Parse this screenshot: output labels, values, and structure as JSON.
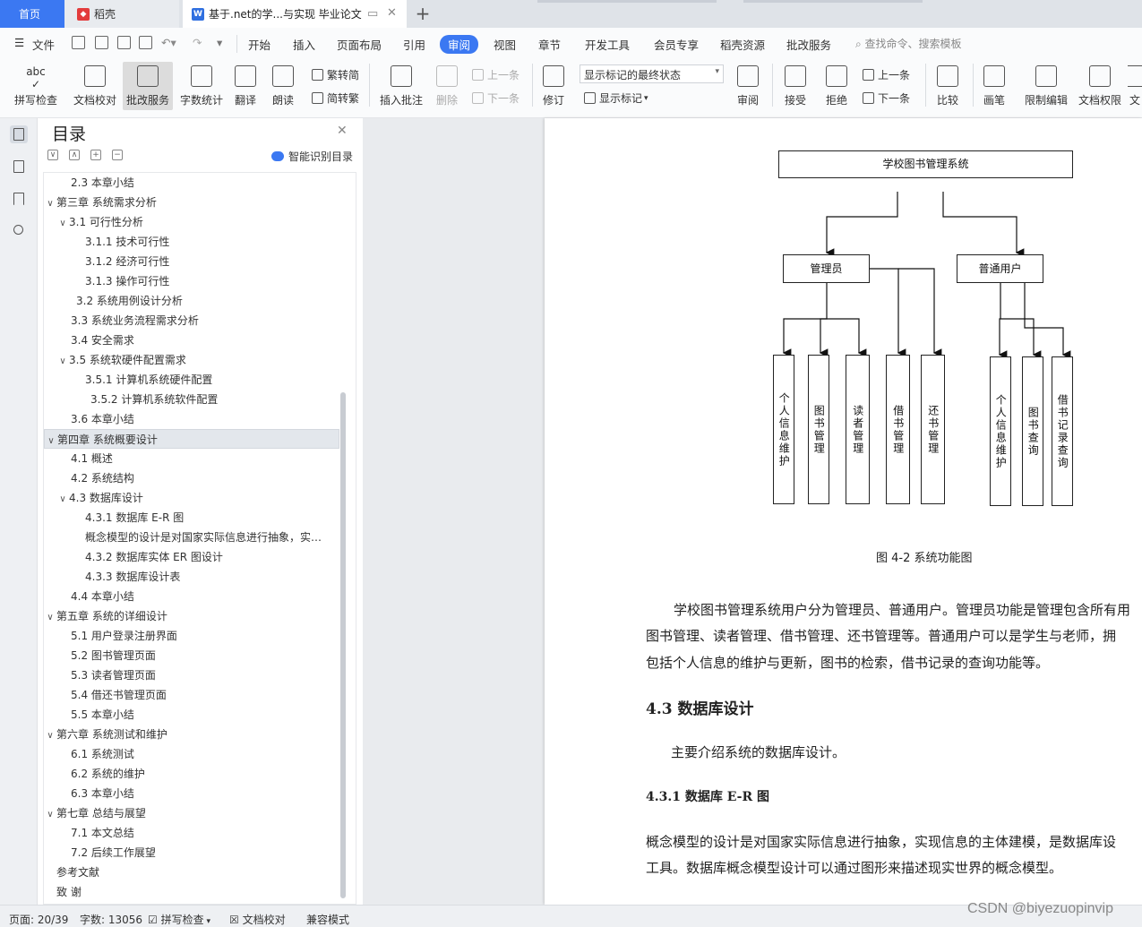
{
  "tabs": {
    "home": "首页",
    "daoke": "稻壳",
    "doc": "基于.net的学...与实现 毕业论文",
    "add": "+"
  },
  "menu": {
    "file": "文件",
    "items": [
      "开始",
      "插入",
      "页面布局",
      "引用",
      "审阅",
      "视图",
      "章节",
      "开发工具",
      "会员专享",
      "稻壳资源",
      "批改服务"
    ],
    "active": "审阅",
    "search": "查找命令、搜索模板"
  },
  "ribbon": {
    "spell": "拼写检查",
    "proof": "文档校对",
    "review_service": "批改服务",
    "wordcount": "字数统计",
    "translate": "翻译",
    "read": "朗读",
    "trad": "繁转简",
    "simp": "简转繁",
    "insert_comment": "插入批注",
    "delete": "删除",
    "prev": "上一条",
    "next": "下一条",
    "revise": "修订",
    "state_select": "显示标记的最终状态",
    "show_marks": "显示标记",
    "review": "审阅",
    "accept": "接受",
    "reject": "拒绝",
    "prev2": "上一条",
    "next2": "下一条",
    "compare": "比较",
    "pen": "画笔",
    "restrict": "限制编辑",
    "docperm": "文档权限",
    "more": "文"
  },
  "toc": {
    "title": "目录",
    "smart": "智能识别目录",
    "items": [
      {
        "text": "2.3 本章小结",
        "lv": 2
      },
      {
        "text": "第三章  系统需求分析",
        "lv": 1,
        "arrow": "∨"
      },
      {
        "text": "3.1 可行性分析",
        "lv": 2,
        "arrow": "∨"
      },
      {
        "text": "3.1.1 技术可行性",
        "lv": 3
      },
      {
        "text": "3.1.2  经济可行性",
        "lv": 3
      },
      {
        "text": "3.1.3 操作可行性",
        "lv": 3
      },
      {
        "text": "3.2 系统用例设计分析",
        "lv": 2.4
      },
      {
        "text": "3.3 系统业务流程需求分析",
        "lv": 2
      },
      {
        "text": "3.4 安全需求",
        "lv": 2
      },
      {
        "text": "3.5 系统软硬件配置需求",
        "lv": 2,
        "arrow": "∨"
      },
      {
        "text": "3.5.1 计算机系统硬件配置",
        "lv": 3
      },
      {
        "text": "3.5.2 计算机系统软件配置",
        "lv": 3.3
      },
      {
        "text": "3.6 本章小结",
        "lv": 2
      },
      {
        "text": "第四章  系统概要设计",
        "lv": 1,
        "arrow": "∨",
        "sel": true
      },
      {
        "text": "4.1 概述",
        "lv": 2
      },
      {
        "text": "4.2 系统结构",
        "lv": 2
      },
      {
        "text": "4.3 数据库设计",
        "lv": 2,
        "arrow": "∨"
      },
      {
        "text": "4.3.1 数据库 E-R 图",
        "lv": 3
      },
      {
        "text": "概念模型的设计是对国家实际信息进行抽象，实…",
        "lv": 3
      },
      {
        "text": "4.3.2 数据库实体 ER 图设计",
        "lv": 3
      },
      {
        "text": "4.3.3 数据库设计表",
        "lv": 3
      },
      {
        "text": "4.4 本章小结",
        "lv": 2
      },
      {
        "text": "第五章  系统的详细设计",
        "lv": 1,
        "arrow": "∨"
      },
      {
        "text": "5.1 用户登录注册界面",
        "lv": 2
      },
      {
        "text": "5.2 图书管理页面",
        "lv": 2
      },
      {
        "text": "5.3  读者管理页面",
        "lv": 2
      },
      {
        "text": "5.4 借还书管理页面",
        "lv": 2
      },
      {
        "text": "5.5 本章小结",
        "lv": 2
      },
      {
        "text": "第六章  系统测试和维护",
        "lv": 1,
        "arrow": "∨"
      },
      {
        "text": "6.1 系统测试",
        "lv": 2
      },
      {
        "text": "6.2 系统的维护",
        "lv": 2
      },
      {
        "text": "6.3 本章小结",
        "lv": 2
      },
      {
        "text": "第七章  总结与展望",
        "lv": 1,
        "arrow": "∨"
      },
      {
        "text": "7.1 本文总结",
        "lv": 2
      },
      {
        "text": "7.2 后续工作展望",
        "lv": 2
      },
      {
        "text": "参考文献",
        "lv": 1
      },
      {
        "text": "致    谢",
        "lv": 1
      }
    ]
  },
  "diagram": {
    "root": "学校图书管理系统",
    "admin": "管理员",
    "user": "普通用户",
    "admin_funcs": [
      "个人信息维护",
      "图书管理",
      "读者管理",
      "借书管理",
      "还书管理"
    ],
    "user_funcs": [
      "个人信息维护",
      "图书查询",
      "借书记录查询"
    ],
    "caption": "图 4-2 系统功能图"
  },
  "doc": {
    "p1": "学校图书管理系统用户分为管理员、普通用户。管理员功能是管理包含所有用",
    "p2": "图书管理、读者管理、借书管理、还书管理等。普通用户可以是学生与老师，拥",
    "p3": "包括个人信息的维护与更新，图书的检索，借书记录的查询功能等。",
    "h2": "4.3 数据库设计",
    "p4": "主要介绍系统的数据库设计。",
    "h3": "4.3.1 数据库 E-R 图",
    "p5": "概念模型的设计是对国家实际信息进行抽象，实现信息的主体建模，是数据库设",
    "p6": "工具。数据库概念模型设计可以通过图形来描述现实世界的概念模型。"
  },
  "status": {
    "page": "页面: 20/39",
    "words": "字数: 13056",
    "spell": "拼写检查",
    "proof": "文档校对",
    "compat": "兼容模式"
  },
  "watermark": "CSDN @biyezuopinvip"
}
